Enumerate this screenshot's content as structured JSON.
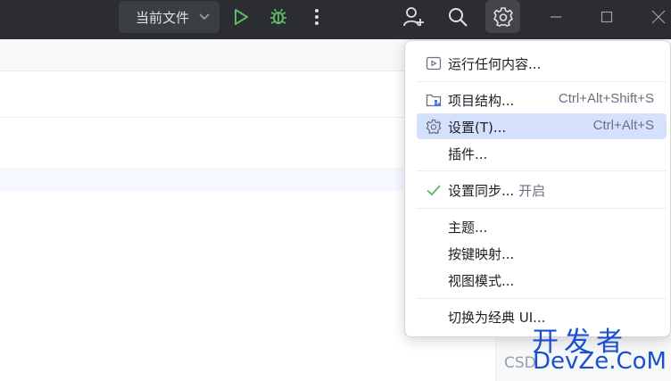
{
  "titlebar": {
    "run_config_label": "当前文件",
    "icons": [
      "chevron-down-icon",
      "run-icon",
      "debug-icon",
      "more-vertical-icon",
      "add-user-icon",
      "search-icon",
      "gear-icon",
      "minimize-icon",
      "maximize-icon",
      "close-icon"
    ]
  },
  "menu": {
    "items": [
      {
        "label": "运行任何内容...",
        "shortcut": "",
        "icon": "run-anything-icon"
      },
      {
        "label": "项目结构...",
        "shortcut": "Ctrl+Alt+Shift+S",
        "icon": "project-structure-icon"
      },
      {
        "label": "设置(T)...",
        "shortcut": "Ctrl+Alt+S",
        "icon": "gear-icon",
        "selected": true
      },
      {
        "label": "插件...",
        "shortcut": ""
      },
      {
        "label": "设置同步...",
        "suffix": "开启",
        "shortcut": "",
        "icon": "check-icon"
      },
      {
        "label": "主题...",
        "shortcut": ""
      },
      {
        "label": "按键映射...",
        "shortcut": ""
      },
      {
        "label": "视图模式...",
        "shortcut": ""
      },
      {
        "label": "切换为经典 UI...",
        "shortcut": ""
      }
    ]
  },
  "watermark": {
    "title": "开发者",
    "site": "DevZe.CoM",
    "csdn": "CSD"
  },
  "colors": {
    "titlebar": "#2b2d30",
    "selection": "#d5e1fc",
    "run_green": "#5fb865",
    "watermark_blue": "#1a4fcf"
  }
}
